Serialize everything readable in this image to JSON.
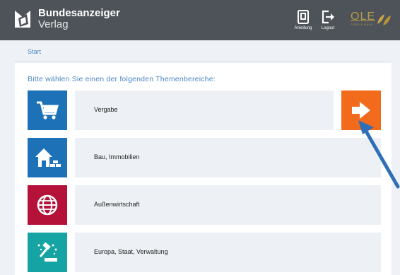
{
  "header": {
    "brand_line1": "Bundesanzeiger",
    "brand_line2": "Verlag",
    "tools": {
      "anleitung_label": "Anleitung",
      "logout_label": "Logout"
    },
    "partner_logo": {
      "text": "OLE",
      "subtext": "FOSS & HAAS"
    }
  },
  "breadcrumb": {
    "label": "Start"
  },
  "main": {
    "heading": "Bitte wählen Sie einen der folgenden Themenbereiche:",
    "topics": [
      {
        "label": "Vergabe",
        "icon": "shopping-cart-icon",
        "color": "#1c71b7"
      },
      {
        "label": "Bau, Immobilien",
        "icon": "house-bricks-icon",
        "color": "#1c71b7"
      },
      {
        "label": "Außenwirtschaft",
        "icon": "globe-icon",
        "color": "#b5123a"
      },
      {
        "label": "Europa, Staat, Verwaltung",
        "icon": "gavel-icon",
        "color": "#16a3a3"
      }
    ],
    "go_button": {
      "icon": "arrow-right-icon",
      "color": "#f26b1d"
    }
  },
  "colors": {
    "header_bg": "#4d5358",
    "accent_link": "#4a86c5",
    "tile_bg": "#edf1f5"
  }
}
